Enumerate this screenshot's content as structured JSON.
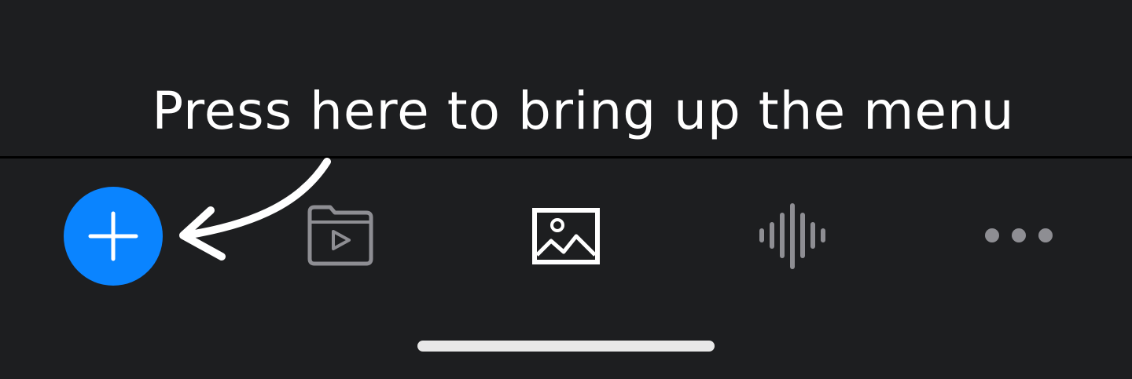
{
  "annotation": {
    "text": "Press here to bring up the menu"
  },
  "tab_bar": {
    "items": [
      {
        "icon": "plus-icon",
        "active": true,
        "color": "#0a84ff"
      },
      {
        "icon": "video-folder-icon",
        "active": false,
        "color": "#8e8e93"
      },
      {
        "icon": "photo-icon",
        "active": true,
        "color": "#ffffff"
      },
      {
        "icon": "audio-waveform-icon",
        "active": false,
        "color": "#8e8e93"
      },
      {
        "icon": "more-icon",
        "active": false,
        "color": "#8e8e93"
      }
    ]
  },
  "colors": {
    "background": "#1d1e20",
    "accent": "#0a84ff",
    "inactive_icon": "#8e8e93",
    "active_icon": "#ffffff"
  }
}
